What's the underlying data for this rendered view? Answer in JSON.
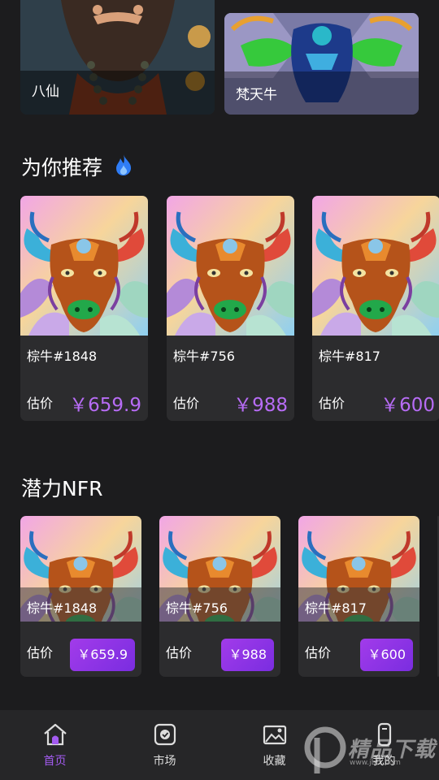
{
  "categories": [
    {
      "label": "八仙"
    },
    {
      "label": "梵天牛"
    }
  ],
  "recommend": {
    "title": "为你推荐",
    "items": [
      {
        "name": "棕牛#1848",
        "est_label": "估价",
        "price": "￥659.9"
      },
      {
        "name": "棕牛#756",
        "est_label": "估价",
        "price": "￥988"
      },
      {
        "name": "棕牛#817",
        "est_label": "估价",
        "price": "￥600"
      }
    ]
  },
  "potential": {
    "title": "潜力NFR",
    "items": [
      {
        "name": "棕牛#1848",
        "est_label": "估价",
        "price": "￥659.9"
      },
      {
        "name": "棕牛#756",
        "est_label": "估价",
        "price": "￥988"
      },
      {
        "name": "棕牛#817",
        "est_label": "估价",
        "price": "￥600"
      }
    ]
  },
  "tabbar": {
    "items": [
      {
        "label": "首页",
        "icon": "home-icon",
        "active": true
      },
      {
        "label": "市场",
        "icon": "market-icon",
        "active": false
      },
      {
        "label": "收藏",
        "icon": "collection-icon",
        "active": false
      },
      {
        "label": "我的",
        "icon": "profile-icon",
        "active": false
      }
    ]
  },
  "watermark": {
    "text": "精品下载",
    "url": "www.jbfx.com"
  },
  "colors": {
    "accent": "#a35bf0",
    "price": "#b76cf5",
    "card_bg": "#2c2c2e",
    "page_bg": "#1c1c1e"
  }
}
